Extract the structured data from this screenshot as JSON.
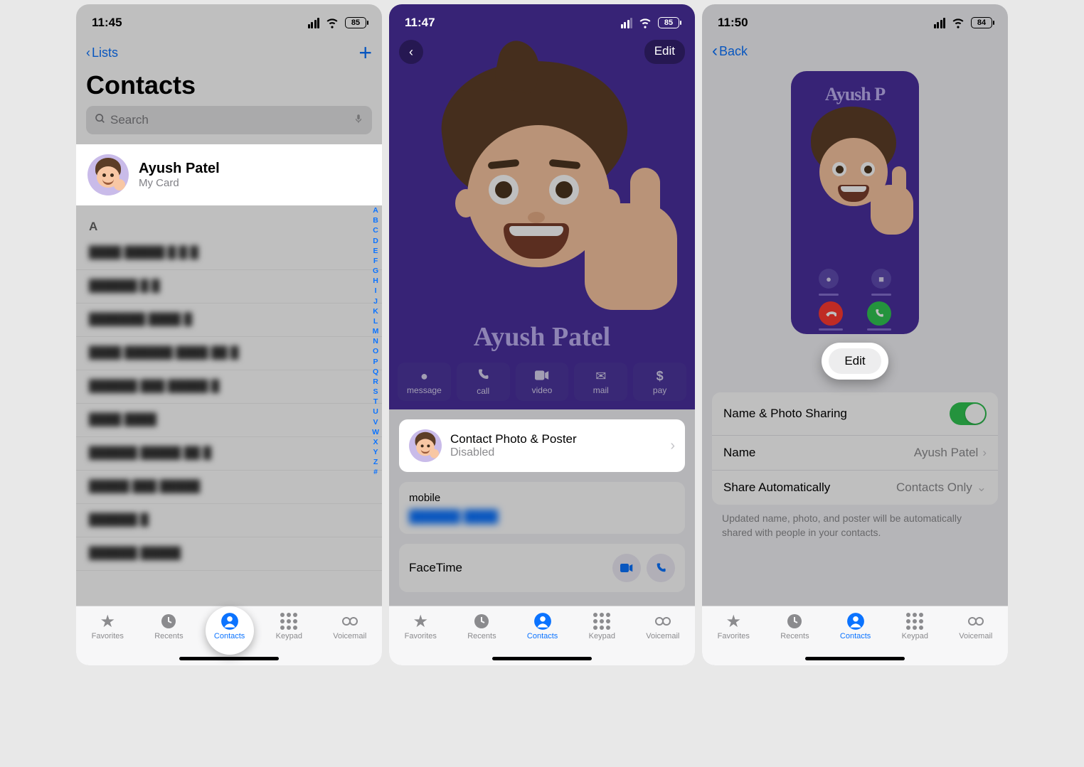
{
  "screen1": {
    "time": "11:45",
    "battery": "85",
    "back_label": "Lists",
    "title": "Contacts",
    "search_placeholder": "Search",
    "mycard": {
      "name": "Ayush Patel",
      "sub": "My Card"
    },
    "section_letter": "A",
    "index_letters": "ABCDEFGHIJKLMNOPQRSTUVWXYZ#",
    "blurred_rows": [
      "████ █████ █ █ █",
      "██████ █ █",
      "███████ ████ █",
      "████ ██████ ████ ██ █",
      "██████ ███ █████ █",
      "████ ████",
      "██████ █████ ██ █",
      "█████ ███ █████",
      "██████ █",
      "██████ █████"
    ],
    "tabs": [
      "Favorites",
      "Recents",
      "Contacts",
      "Keypad",
      "Voicemail"
    ]
  },
  "screen2": {
    "time": "11:47",
    "battery": "85",
    "edit": "Edit",
    "poster_name": "Ayush Patel",
    "actions": [
      {
        "icon": "💬",
        "label": "message"
      },
      {
        "icon": "phone",
        "label": "call"
      },
      {
        "icon": "■",
        "label": "video"
      },
      {
        "icon": "✉",
        "label": "mail"
      },
      {
        "icon": "$",
        "label": "pay"
      }
    ],
    "cpp_title": "Contact Photo & Poster",
    "cpp_sub": "Disabled",
    "mobile_label": "mobile",
    "mobile_value": "██████ ████",
    "facetime": "FaceTime",
    "tabs": [
      "Favorites",
      "Recents",
      "Contacts",
      "Keypad",
      "Voicemail"
    ]
  },
  "screen3": {
    "time": "11:50",
    "battery": "84",
    "back_label": "Back",
    "poster_name": "Ayush P",
    "edit_btn": "Edit",
    "rows": {
      "share_label": "Name & Photo Sharing",
      "name_label": "Name",
      "name_value": "Ayush Patel",
      "auto_label": "Share Automatically",
      "auto_value": "Contacts Only"
    },
    "footer": "Updated name, photo, and poster will be automatically shared with people in your contacts.",
    "tabs": [
      "Favorites",
      "Recents",
      "Contacts",
      "Keypad",
      "Voicemail"
    ]
  }
}
